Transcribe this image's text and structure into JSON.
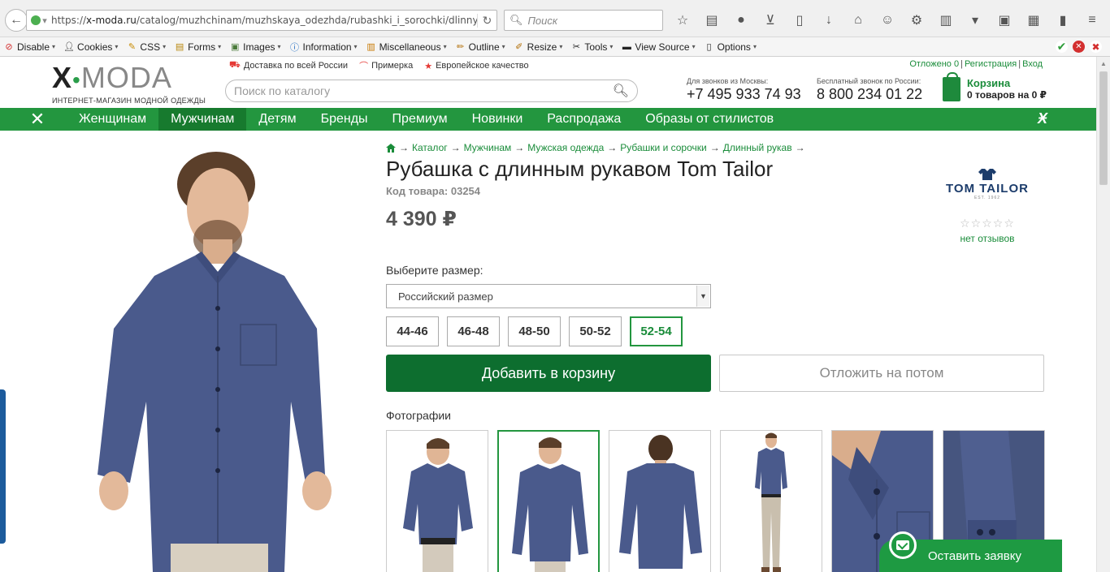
{
  "browser": {
    "url_prefix": "https://",
    "url_host": "x-moda.ru",
    "url_path": "/catalog/muzhchinam/muzhskaya_odezhda/rubashki_i_sorochki/dlinnyy_",
    "search_placeholder": "Поиск"
  },
  "addon_bar": {
    "items": [
      {
        "label": "Disable",
        "icon": "no-entry-icon"
      },
      {
        "label": "Cookies",
        "icon": "person-icon"
      },
      {
        "label": "CSS",
        "icon": "wand-icon"
      },
      {
        "label": "Forms",
        "icon": "form-icon"
      },
      {
        "label": "Images",
        "icon": "image-icon"
      },
      {
        "label": "Information",
        "icon": "info-icon"
      },
      {
        "label": "Miscellaneous",
        "icon": "misc-icon"
      },
      {
        "label": "Outline",
        "icon": "pencil-icon"
      },
      {
        "label": "Resize",
        "icon": "resize-icon"
      },
      {
        "label": "Tools",
        "icon": "tools-icon"
      },
      {
        "label": "View Source",
        "icon": "source-icon"
      },
      {
        "label": "Options",
        "icon": "options-icon"
      }
    ]
  },
  "header": {
    "logo_left": "X",
    "logo_right": "MODA",
    "logo_tagline": "ИНТЕРНЕТ-МАГАЗИН МОДНОЙ ОДЕЖДЫ",
    "perks": [
      {
        "label": "Доставка по всей России",
        "icon": "truck-icon"
      },
      {
        "label": "Примерка",
        "icon": "hanger-icon"
      },
      {
        "label": "Европейское качество",
        "icon": "star-icon"
      }
    ],
    "account": {
      "wishlist": "Отложено 0",
      "register": "Регистрация",
      "login": "Вход"
    },
    "search_placeholder": "Поиск по каталогу",
    "phone_moscow_label": "Для звонков из Москвы:",
    "phone_moscow": "+7 495 933 74 93",
    "phone_free_label": "Бесплатный звонок по России:",
    "phone_free": "8 800 234 01 22",
    "cart_title": "Корзина",
    "cart_status": "0 товаров на 0 ₽"
  },
  "nav": {
    "items": [
      "Женщинам",
      "Мужчинам",
      "Детям",
      "Бренды",
      "Премиум",
      "Новинки",
      "Распродажа",
      "Образы от стилистов"
    ],
    "active": "Мужчинам"
  },
  "product": {
    "breadcrumbs": [
      "Каталог",
      "Мужчинам",
      "Мужская одежда",
      "Рубашки и сорочки",
      "Длинный рукав"
    ],
    "title": "Рубашка с длинным рукавом Tom Tailor",
    "code": "Код товара: 03254",
    "price": "4 390 ₽",
    "brand": "TOM TAILOR",
    "brand_est": "EST. 1962",
    "rating_stars": "☆☆☆☆☆",
    "reviews": "нет отзывов",
    "size_label": "Выберите размер:",
    "size_system": "Российский размер",
    "sizes": [
      "44-46",
      "46-48",
      "48-50",
      "50-52",
      "52-54"
    ],
    "selected_size": "52-54",
    "add_to_cart": "Добавить в корзину",
    "save_later": "Отложить на потом",
    "photos_label": "Фотографии",
    "selected_photo": 1
  },
  "callback": {
    "label": "Оставить заявку"
  },
  "colors": {
    "brand_green": "#23963f",
    "dark_green": "#0d6e2f",
    "shirt_blue": "#4a5a8c",
    "link_green": "#1a8c3a"
  }
}
